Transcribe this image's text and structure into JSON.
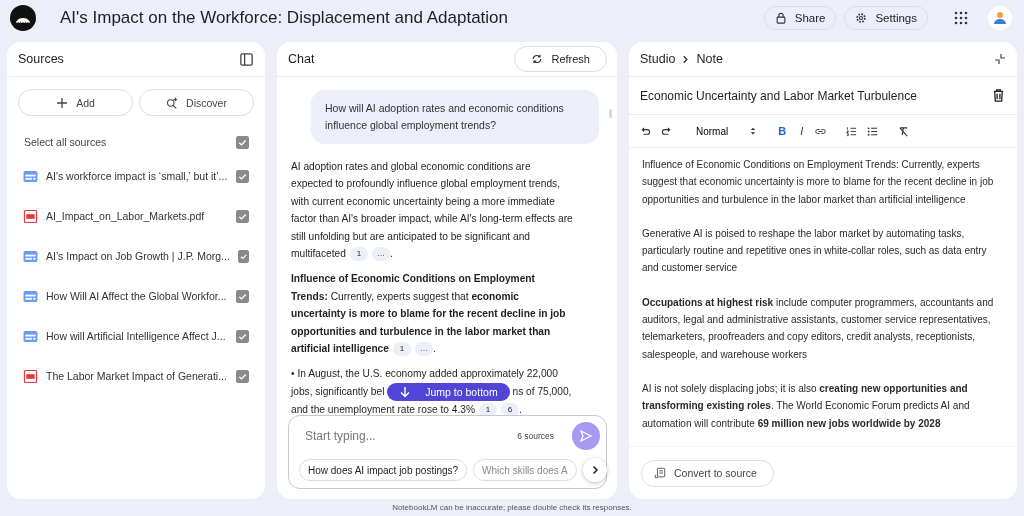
{
  "header": {
    "title": "AI's Impact on the Workforce: Displacement and Adaptation",
    "share": "Share",
    "settings": "Settings"
  },
  "sources": {
    "title": "Sources",
    "add": "Add",
    "discover": "Discover",
    "select_all": {
      "label": "Select all sources",
      "checked": true
    },
    "items": [
      {
        "kind": "web",
        "name": "AI's workforce impact is ‘small,’ but it’...",
        "checked": true
      },
      {
        "kind": "pdf",
        "name": "AI_Impact_on_Labor_Markets.pdf",
        "checked": true
      },
      {
        "kind": "web",
        "name": "AI’s Impact on Job Growth | J.P. Morg...",
        "checked": true
      },
      {
        "kind": "web",
        "name": "How Will AI Affect the Global Workfor...",
        "checked": true
      },
      {
        "kind": "web",
        "name": "How will Artificial Intelligence Affect J...",
        "checked": true
      },
      {
        "kind": "pdf",
        "name": "The Labor Market Impact of Generati...",
        "checked": true
      }
    ]
  },
  "chat": {
    "title": "Chat",
    "refresh": "Refresh",
    "question": "How will AI adoption rates and economic conditions influence global employment trends?",
    "paragraphs": [
      {
        "text": "AI adoption rates and global economic conditions are expected to profoundly influence global employment trends, with current economic uncertainty being a more immediate factor than AI's broader impact, while AI's long-term effects are still unfolding but are anticipated to be significant and multifaceted",
        "citations": [
          "1",
          "…"
        ],
        "end": "."
      },
      {
        "text": "**Influence of Economic Conditions on Employment Trends:** Currently, experts suggest that **economic uncertainty is more to blame for the recent decline in job opportunities and turbulence in the labor market than artificial intelligence**",
        "citations": [
          "1",
          "…"
        ],
        "end": "."
      }
    ],
    "bullet": {
      "before": "• In August, the U.S. economy added approximately 22,000 jobs, significantly bel",
      "after": "ns of 75,000, and the unemployment rate rose to 4.3%",
      "citations": [
        "1",
        "6"
      ],
      "end": "."
    },
    "jump_button": "Jump to bottom",
    "input": {
      "placeholder": "Start typing...",
      "source_count": "6 sources"
    },
    "suggestions": [
      "How does AI impact job postings?",
      "Which skills does A"
    ]
  },
  "studio": {
    "breadcrumb": [
      "Studio",
      "Note"
    ],
    "note_title": "Economic Uncertainty and Labor Market Turbulence",
    "style": "Normal",
    "format_buttons": [
      {
        "label": "B",
        "selected": true
      },
      {
        "label": "I",
        "selected": false
      }
    ],
    "paragraphs": [
      "Influence of Economic Conditions on Employment Trends: Currently, experts suggest that economic uncertainty is more to blame for the recent decline in job opportunities and turbulence in the labor market than artificial intelligence",
      "Generative AI is poised to reshape the labor market by automating tasks, particularly routine and repetitive ones in white-collar roles, such as data entry and customer service",
      "**Occupations at highest risk** include computer programmers, accountants and auditors, legal and administrative assistants, customer service representatives, telemarketers, proofreaders and copy editors, credit analysts, receptionists, salespeople, and warehouse workers",
      "AI is not solely displacing jobs; it is also **creating new opportunities and transforming existing roles**. The World Economic Forum predicts AI and automation will contribute **69 million new jobs worldwide by 2028**"
    ],
    "convert": "Convert to source"
  },
  "footer_note": "NotebookLM can be inaccurate; please double check its responses."
}
